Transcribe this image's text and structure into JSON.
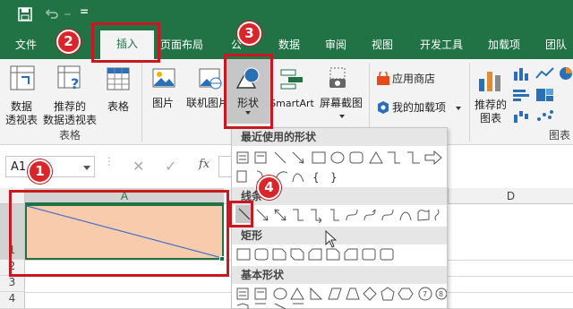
{
  "qat": {
    "customize_glyph": "="
  },
  "tabs": [
    {
      "label": "文件"
    },
    {
      "label": "插入"
    },
    {
      "label": "页面布局"
    },
    {
      "label": "公"
    },
    {
      "label": "数据"
    },
    {
      "label": "审阅"
    },
    {
      "label": "视图"
    },
    {
      "label": "开发工具"
    },
    {
      "label": "加载项"
    },
    {
      "label": "团队"
    }
  ],
  "ribbon": {
    "pivot_line1": "数据",
    "pivot_line2": "透视表",
    "rec_pivot_line1": "推荐的",
    "rec_pivot_line2": "数据透视表",
    "table": "表格",
    "group_tables": "表格",
    "picture": "图片",
    "online_picture": "联机图片",
    "shapes": "形状",
    "smartart": "SmartArt",
    "screenshot": "屏幕截图",
    "app_store": "应用商店",
    "my_addins": "我的加载项",
    "rec_chart_line1": "推荐的",
    "rec_chart_line2": "图表",
    "group_charts": "图表"
  },
  "formula_bar": {
    "name_box": "A1",
    "fx": "fx"
  },
  "grid": {
    "col_a": "A",
    "col_d": "D",
    "rows": [
      "1",
      "2",
      "3",
      "4"
    ]
  },
  "shapes_dropdown": {
    "recent_header": "最近使用的形状",
    "lines_header": "线条",
    "rect_header": "矩形",
    "basic_header": "基本形状",
    "recent_text1": "{",
    "recent_text2": "}"
  },
  "markers": [
    "1",
    "2",
    "3",
    "4"
  ],
  "colors": {
    "accent": "#217346",
    "highlight": "#c9191e",
    "cell_fill": "#f8cbad",
    "line": "#4472c4"
  }
}
